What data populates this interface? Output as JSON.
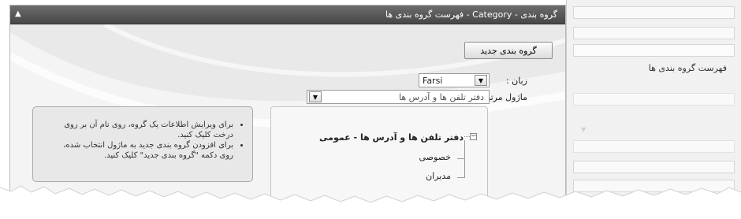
{
  "sidebar": {
    "active_item_label": "فهرست گروه بندی ها"
  },
  "panel": {
    "title": "گروه بندی - Category - فهرست گروه بندی ها",
    "collapse_icon": "chevron-up-icon",
    "new_button_label": "گروه بندی جدید",
    "language": {
      "label": "زبان :",
      "value": "Farsi"
    },
    "module": {
      "label": "ماژول مرتبط :",
      "value": "دفتر تلفن ها و آدرس ها"
    },
    "tree": {
      "root": "دفتر تلفن ها و آدرس ها - عمومی",
      "children": [
        "خصوصی",
        "مدیران"
      ]
    },
    "help": [
      "برای ویرایش اطلاعات یک گروه، روی نام آن بر روی درخت کلیک کنید.",
      "برای افزودن گروه بندی جدید به ماژول انتخاب شده، روی دکمه \"گروه بندی جدید\" کلیک کنید."
    ]
  },
  "colors": {
    "titlebar": "#474747",
    "panel_bg": "#f4f4f4",
    "infobox_bg": "#e8e8e8"
  }
}
